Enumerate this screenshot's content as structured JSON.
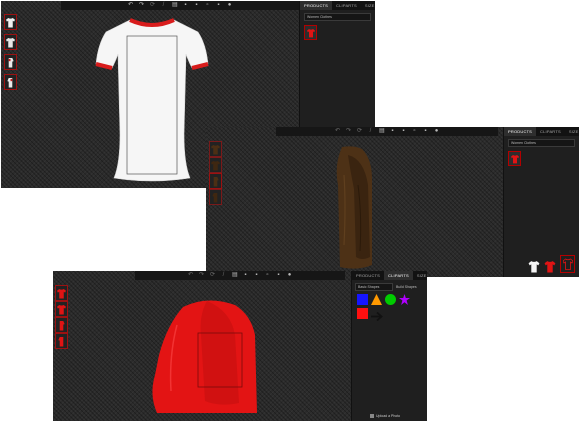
{
  "screens": [
    {
      "toolbar_icons": [
        "undo-icon",
        "redo-icon",
        "rotate-icon",
        "pencil-icon",
        "layers-icon",
        "shirt-front-icon",
        "shirt-back-icon",
        "shirt-left-icon",
        "shirt-right-icon",
        "zoom-icon"
      ],
      "tabs": [
        {
          "label": "PRODUCTS"
        },
        {
          "label": "CLIPARTS"
        },
        {
          "label": "SIZE"
        }
      ],
      "select_value": "Women Clothes",
      "views": [
        "front",
        "back",
        "left",
        "right"
      ]
    },
    {
      "tabs": [
        {
          "label": "PRODUCTS"
        },
        {
          "label": "CLIPARTS"
        },
        {
          "label": "SIZE"
        }
      ],
      "select_value": "Women Clothes",
      "bottom_swatches": [
        "white-shirt",
        "red-shirt",
        "outline-shirt"
      ]
    },
    {
      "tabs": [
        {
          "label": "PRODUCTS"
        },
        {
          "label": "CLIPARTS"
        },
        {
          "label": "SIZE"
        }
      ],
      "select_value": "Basic Shapes",
      "link_label": "Build Shapes",
      "shapes": [
        {
          "name": "square",
          "color": "#1515ff"
        },
        {
          "name": "triangle",
          "color": "#ff9900"
        },
        {
          "name": "circle",
          "color": "#00cc00"
        },
        {
          "name": "star",
          "color": "#b000ff"
        },
        {
          "name": "square",
          "color": "#ff1010"
        },
        {
          "name": "arrow",
          "color": "#111111"
        }
      ],
      "upload_label": "Upload a Photo"
    }
  ],
  "colors": {
    "accent": "#d11414",
    "shirt_white": "#f5f5f5",
    "shirt_brown": "#4b2f14",
    "shirt_red": "#e01414"
  }
}
